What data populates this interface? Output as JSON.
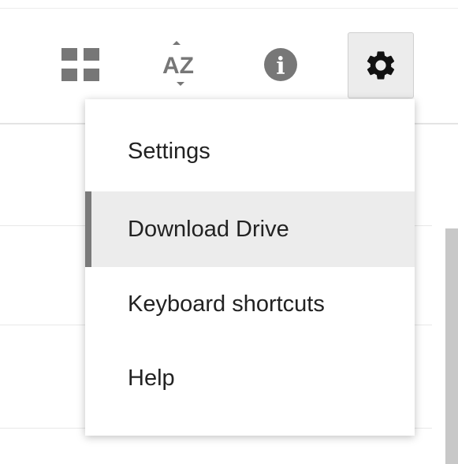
{
  "toolbar": {
    "grid_icon": "grid-view-icon",
    "sort_icon": "sort-az-icon",
    "sort_glyph": "AZ",
    "info_icon": "info-icon",
    "info_glyph": "i",
    "settings_icon": "gear-icon"
  },
  "settings_menu": {
    "items": [
      {
        "label": "Settings"
      },
      {
        "label": "Download Drive",
        "highlighted": true
      },
      {
        "label": "Keyboard shortcuts"
      },
      {
        "label": "Help"
      }
    ]
  },
  "colors": {
    "icon_gray": "#777777",
    "settings_button_bg": "#ececec",
    "menu_highlight_bg": "#ececec",
    "menu_selected_bar": "#7a7a7a",
    "text": "#222222"
  }
}
